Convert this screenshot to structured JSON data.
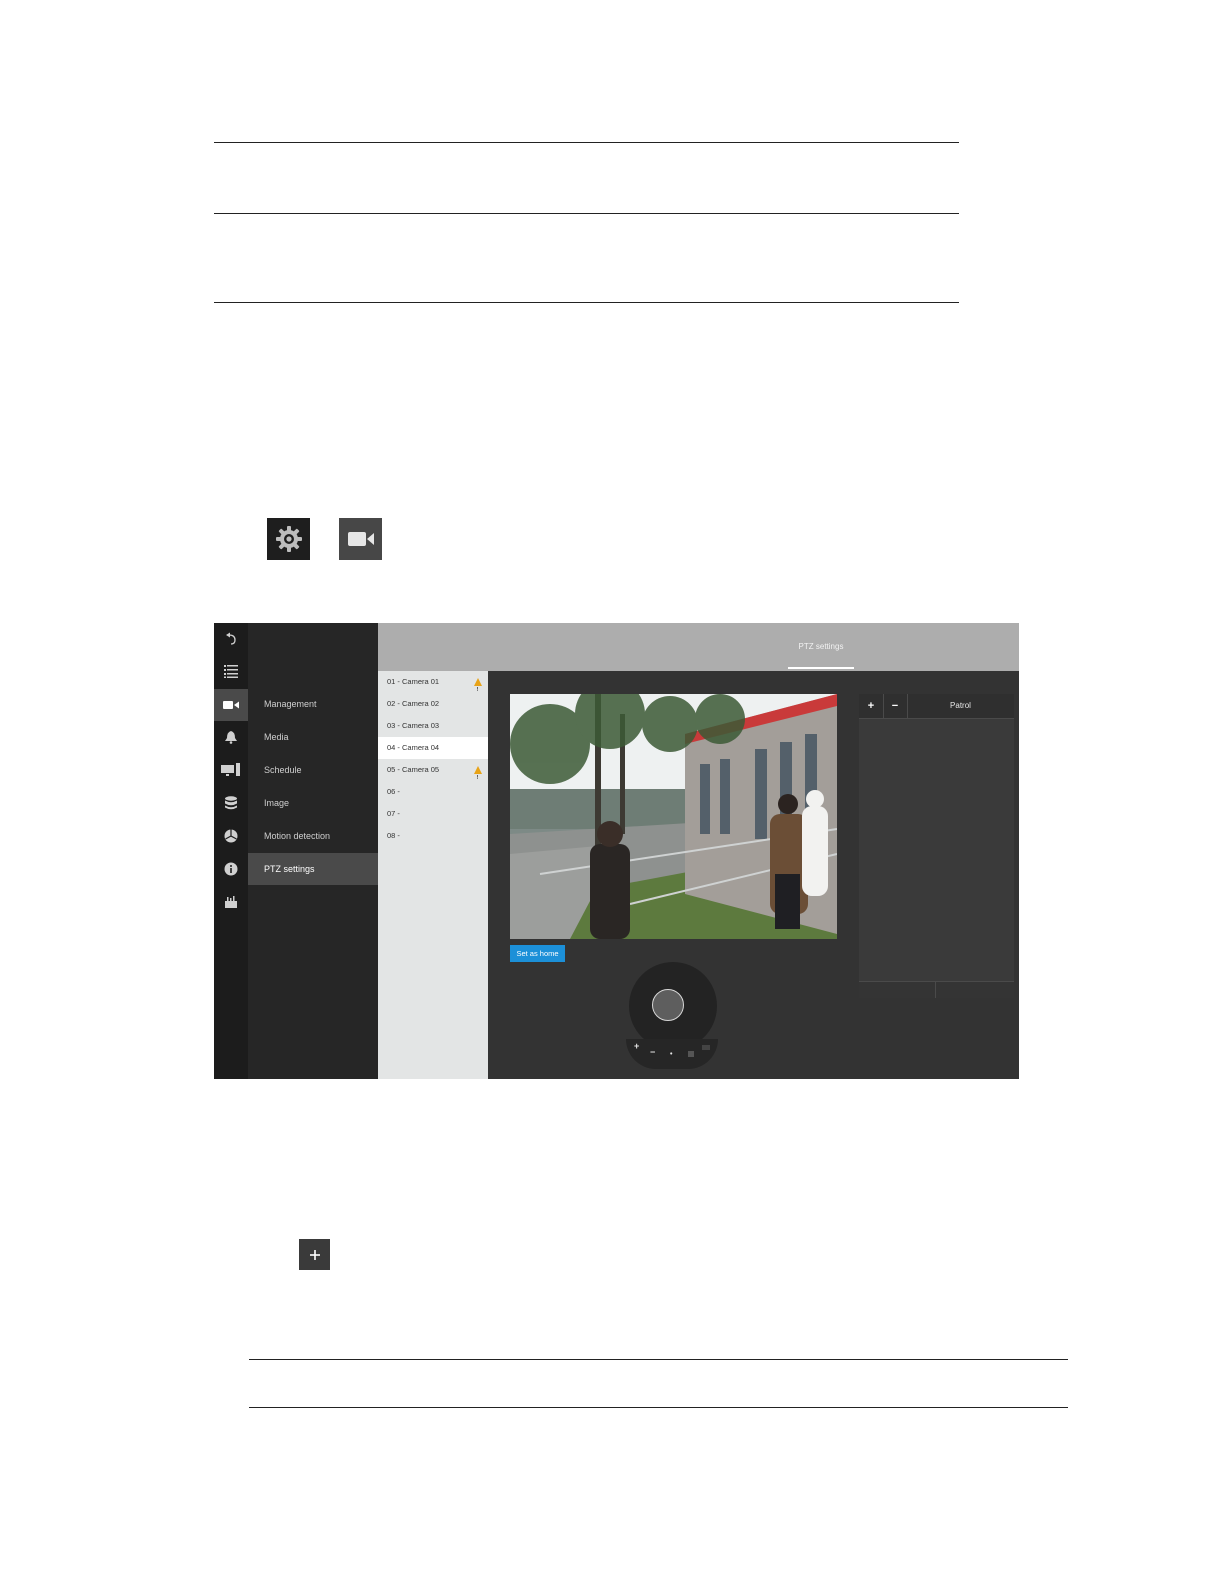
{
  "doc": {
    "icons": [
      "gear-icon",
      "video-camera-icon",
      "plus-icon"
    ]
  },
  "screenshot": {
    "rail_icons": [
      "back-arrow-icon",
      "list-icon",
      "video-camera-icon",
      "bell-icon",
      "monitor-icon",
      "database-icon",
      "network-icon",
      "info-icon",
      "toolbox-icon"
    ],
    "menu": {
      "items": [
        {
          "label": "Management"
        },
        {
          "label": "Media"
        },
        {
          "label": "Schedule"
        },
        {
          "label": "Image"
        },
        {
          "label": "Motion detection"
        },
        {
          "label": "PTZ settings"
        }
      ],
      "active": "PTZ settings"
    },
    "tab": {
      "label": "PTZ settings"
    },
    "cameras": [
      {
        "label": "01 - Camera 01",
        "warning": true
      },
      {
        "label": "02 - Camera 02",
        "warning": false
      },
      {
        "label": "03 - Camera 03",
        "warning": false
      },
      {
        "label": "04 - Camera 04",
        "warning": false,
        "selected": true
      },
      {
        "label": "05 - Camera 05",
        "warning": true
      },
      {
        "label": "06 -",
        "warning": false
      },
      {
        "label": "07 -",
        "warning": false
      },
      {
        "label": "08 -",
        "warning": false
      }
    ],
    "set_home_label": "Set as home",
    "zoom": {
      "plus": "+",
      "minus": "−",
      "dot": "•"
    },
    "patrol": {
      "add": "+",
      "remove": "−",
      "title": "Patrol"
    },
    "colors": {
      "accent": "#1c90d8",
      "warning": "#e8a317"
    }
  }
}
